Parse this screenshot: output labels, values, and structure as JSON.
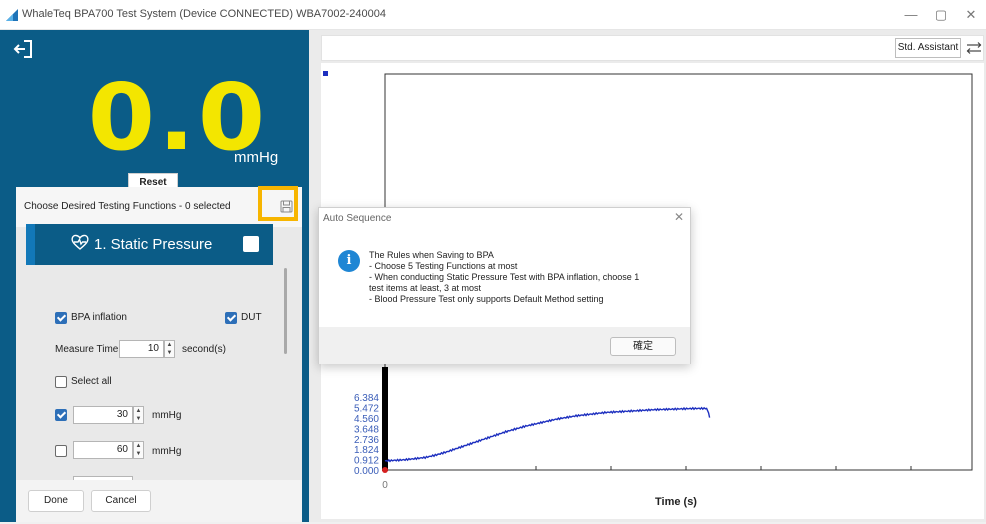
{
  "window": {
    "title": "WhaleTeq BPA700 Test System (Device CONNECTED)    WBA7002-240004",
    "minimize": "—",
    "restore": "▢",
    "close": "✕"
  },
  "pressure": {
    "value": "0.0",
    "unit": "mmHg",
    "reset_label": "Reset",
    "color": "#f3e600"
  },
  "functions": {
    "title": "Choose Desired Testing Functions - 0 selected",
    "static_pressure": {
      "label": "1. Static Pressure",
      "bpa_inflation_label": "BPA inflation",
      "bpa_inflation_checked": true,
      "dut_label": "DUT",
      "dut_checked": true,
      "measure_time_label": "Measure Time",
      "measure_time_value": "10",
      "measure_time_unit": "second(s)",
      "select_all_label": "Select all",
      "select_all_checked": false,
      "items": [
        {
          "value": "30",
          "unit": "mmHg",
          "checked": true
        },
        {
          "value": "60",
          "unit": "mmHg",
          "checked": false
        }
      ]
    },
    "done_label": "Done",
    "cancel_label": "Cancel"
  },
  "toolbar": {
    "std_assistant_label": "Std. Assistant"
  },
  "chart_data": {
    "type": "line",
    "title": "",
    "xlabel": "Time (s)",
    "ylabel": "",
    "x_ticks": [
      "0"
    ],
    "y_ticks": [
      "0.000",
      "0.912",
      "1.824",
      "2.736",
      "3.648",
      "4.560",
      "5.472",
      "6.384"
    ],
    "ylim": [
      0,
      6.384
    ],
    "series": [
      {
        "color": "#1d2fbf",
        "x": [
          0,
          1,
          2,
          3,
          4,
          5,
          6,
          7,
          8,
          9,
          10,
          11,
          12,
          13,
          14,
          15,
          16,
          17,
          18,
          19,
          20,
          21,
          22,
          23,
          24,
          25,
          26,
          27,
          28,
          29,
          30,
          31,
          32,
          32.2,
          32.3
        ],
        "y": [
          0.8,
          0.85,
          0.9,
          1.0,
          1.1,
          1.3,
          1.55,
          1.85,
          2.15,
          2.45,
          2.75,
          3.05,
          3.35,
          3.6,
          3.85,
          4.05,
          4.25,
          4.45,
          4.6,
          4.75,
          4.85,
          4.95,
          5.05,
          5.1,
          5.15,
          5.2,
          5.25,
          5.3,
          5.32,
          5.35,
          5.38,
          5.4,
          5.4,
          5.0,
          4.6
        ]
      }
    ],
    "grid": false
  },
  "dialog": {
    "title": "Auto Sequence",
    "close": "✕",
    "icon": "info-icon",
    "lines": [
      "The Rules when Saving to BPA",
      "- Choose 5 Testing Functions at most",
      "- When conducting Static Pressure Test with BPA inflation, choose 1",
      "test items at least, 3 at most",
      "- Blood Pressure Test only supports Default Method setting"
    ],
    "ok_label": "確定"
  },
  "colors": {
    "panel": "#0b5c87",
    "accent": "#f7b500",
    "line": "#1d2fbf"
  }
}
